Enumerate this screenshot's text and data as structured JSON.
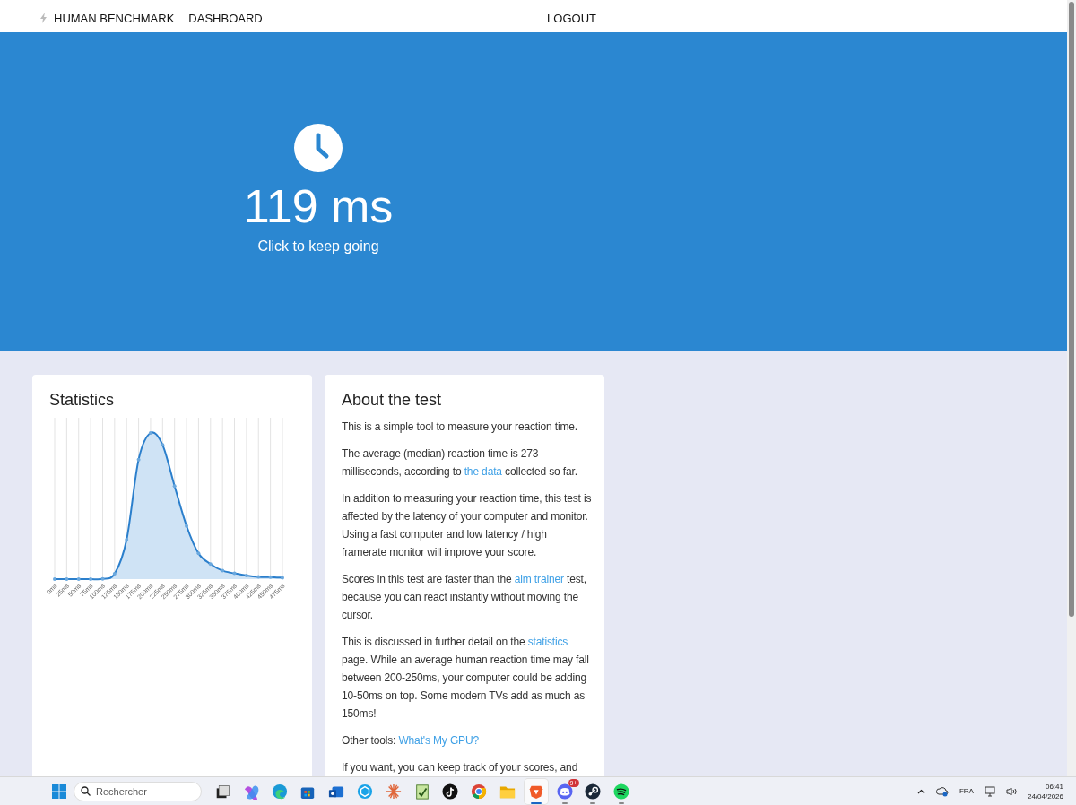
{
  "nav": {
    "brand": "HUMAN BENCHMARK",
    "links": [
      "DASHBOARD"
    ],
    "logout": "LOGOUT"
  },
  "hero": {
    "result": "119 ms",
    "hint": "Click to keep going"
  },
  "statistics": {
    "title": "Statistics",
    "x_labels": [
      "0ms",
      "25ms",
      "50ms",
      "75ms",
      "100ms",
      "125ms",
      "150ms",
      "175ms",
      "200ms",
      "225ms",
      "250ms",
      "275ms",
      "300ms",
      "325ms",
      "350ms",
      "375ms",
      "400ms",
      "425ms",
      "450ms",
      "475ms"
    ]
  },
  "about": {
    "title": "About the test",
    "paragraphs": [
      [
        {
          "kind": "plain",
          "text": "This is a simple tool to measure your reaction time."
        }
      ],
      [
        {
          "kind": "plain",
          "text": "The average (median) reaction time is 273 milliseconds, according to "
        },
        {
          "kind": "link",
          "text": "the data"
        },
        {
          "kind": "plain",
          "text": " collected so far."
        }
      ],
      [
        {
          "kind": "plain",
          "text": "In addition to measuring your reaction time, this test is affected by the latency of your computer and monitor. Using a fast computer and low latency / high framerate monitor will improve your score."
        }
      ],
      [
        {
          "kind": "plain",
          "text": "Scores in this test are faster than the "
        },
        {
          "kind": "link",
          "text": "aim trainer"
        },
        {
          "kind": "plain",
          "text": " test, because you can react instantly without moving the cursor."
        }
      ],
      [
        {
          "kind": "plain",
          "text": "This is discussed in further detail on the "
        },
        {
          "kind": "link",
          "text": "statistics"
        },
        {
          "kind": "plain",
          "text": " page. While an average human reaction time may fall between 200-250ms, your computer could be adding 10-50ms on top. Some modern TVs add as much as 150ms!"
        }
      ],
      [
        {
          "kind": "plain",
          "text": "Other tools: "
        },
        {
          "kind": "link",
          "text": "What's My GPU?"
        }
      ],
      [
        {
          "kind": "plain",
          "text": "If you want, you can keep track of your scores, and"
        }
      ]
    ]
  },
  "taskbar": {
    "search": {
      "placeholder": "Rechercher"
    },
    "apps": [
      {
        "kind": "taskview",
        "running": false,
        "selected": false
      },
      {
        "kind": "copilot",
        "running": false,
        "selected": false
      },
      {
        "kind": "edge",
        "running": false,
        "selected": false
      },
      {
        "kind": "store",
        "running": false,
        "selected": false
      },
      {
        "kind": "outlook",
        "running": false,
        "selected": false
      },
      {
        "kind": "cube",
        "running": false,
        "selected": false
      },
      {
        "kind": "burst",
        "running": false,
        "selected": false
      },
      {
        "kind": "notepad",
        "running": false,
        "selected": false
      },
      {
        "kind": "tiktok",
        "running": false,
        "selected": false
      },
      {
        "kind": "chrome",
        "running": false,
        "selected": false
      },
      {
        "kind": "folder",
        "running": false,
        "selected": false
      },
      {
        "kind": "brave",
        "running": true,
        "selected": true
      },
      {
        "kind": "discord",
        "running": true,
        "selected": false,
        "badge": "9+"
      },
      {
        "kind": "steam",
        "running": true,
        "selected": false
      },
      {
        "kind": "spotify",
        "running": true,
        "selected": false
      }
    ],
    "tray": {
      "language": "FRA",
      "time": "06:41",
      "date": "24/04/2026"
    }
  }
}
